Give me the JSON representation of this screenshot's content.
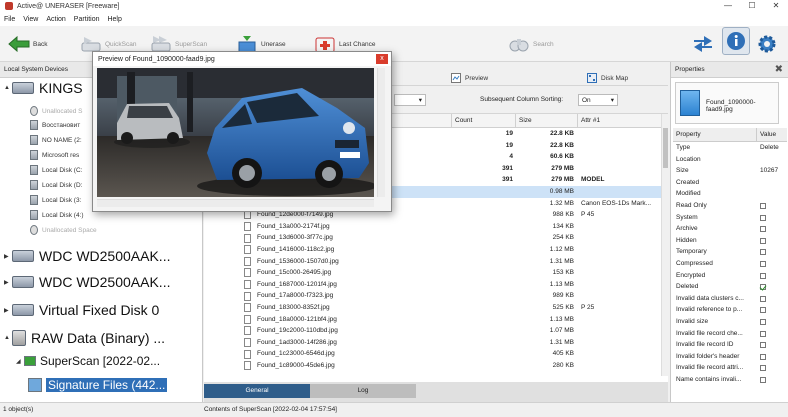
{
  "window": {
    "title": "Active@ UNERASER [Freeware]",
    "minimize": "—",
    "maximize": "☐",
    "close": "✕"
  },
  "menu": [
    "File",
    "View",
    "Action",
    "Partition",
    "Help"
  ],
  "toolbar": {
    "back": "Back",
    "quickscan": "QuickScan",
    "superscan": "SuperScan",
    "unerase": "Unerase",
    "lastchance": "Last Chance",
    "search": "Search"
  },
  "left_pane": {
    "header": "Local System Devices",
    "items": [
      {
        "label": "KINGS",
        "kind": "disk"
      },
      {
        "label": "Unallocated S",
        "kind": "unalloc"
      },
      {
        "label": "Восстановит",
        "kind": "vol"
      },
      {
        "label": "NO NAME (2:",
        "kind": "vol"
      },
      {
        "label": "Microsoft res",
        "kind": "vol"
      },
      {
        "label": "Local Disk (C:",
        "kind": "vol"
      },
      {
        "label": "Local Disk (D:",
        "kind": "vol"
      },
      {
        "label": "Local Disk (3:",
        "kind": "vol"
      },
      {
        "label": "Local Disk (4:)",
        "kind": "vol"
      },
      {
        "label": "Unallocated Space",
        "kind": "unalloc"
      },
      {
        "label": "WDC WD2500AAK...",
        "kind": "disk"
      },
      {
        "label": "WDC WD2500AAK...",
        "kind": "disk"
      },
      {
        "label": "Virtual Fixed Disk 0",
        "kind": "disk"
      },
      {
        "label": "RAW Data (Binary) ...",
        "kind": "raw"
      },
      {
        "label": "SuperScan [2022-02...",
        "kind": "scan"
      },
      {
        "label": "Signature Files (442...",
        "kind": "sig"
      }
    ]
  },
  "middle": {
    "preview_btn": "Preview",
    "diskmap_btn": "Disk Map",
    "subsequent_label": "Subsequent Column Sorting:",
    "subsequent_value": "On",
    "columns": [
      "Count",
      "Size",
      "Attr #1"
    ],
    "rows": [
      {
        "name": "",
        "count": "19",
        "size": "22.8 KB",
        "attr": "",
        "bold": true
      },
      {
        "name": "",
        "count": "19",
        "size": "22.8 KB",
        "attr": "",
        "bold": true
      },
      {
        "name": "",
        "count": "4",
        "size": "60.6 KB",
        "attr": "",
        "bold": true
      },
      {
        "name": "",
        "count": "391",
        "size": "279 MB",
        "attr": "",
        "bold": true
      },
      {
        "name": "",
        "count": "391",
        "size": "279 MB",
        "attr": "MODEL",
        "bold": true
      },
      {
        "name": "",
        "count": "",
        "size": "0.98 MB",
        "attr": "",
        "sel": true
      },
      {
        "name": "",
        "count": "",
        "size": "1.32 MB",
        "attr": "Canon EOS-1Ds Mark..."
      },
      {
        "name": "Found_12de000-f7149.jpg",
        "count": "",
        "size": "988 KB",
        "attr": "P 45"
      },
      {
        "name": "Found_13a000-2174f.jpg",
        "count": "",
        "size": "134 KB",
        "attr": ""
      },
      {
        "name": "Found_13d6000-3f77c.jpg",
        "count": "",
        "size": "254 KB",
        "attr": ""
      },
      {
        "name": "Found_1416000-118c2.jpg",
        "count": "",
        "size": "1.12 MB",
        "attr": ""
      },
      {
        "name": "Found_1536000-1507d0.jpg",
        "count": "",
        "size": "1.31 MB",
        "attr": ""
      },
      {
        "name": "Found_15c000-26495.jpg",
        "count": "",
        "size": "153 KB",
        "attr": ""
      },
      {
        "name": "Found_1687000-1201f4.jpg",
        "count": "",
        "size": "1.13 MB",
        "attr": ""
      },
      {
        "name": "Found_17a8000-f7323.jpg",
        "count": "",
        "size": "989 KB",
        "attr": ""
      },
      {
        "name": "Found_183000-8352f.jpg",
        "count": "",
        "size": "525 KB",
        "attr": "P 25"
      },
      {
        "name": "Found_18a0000-121bf4.jpg",
        "count": "",
        "size": "1.13 MB",
        "attr": ""
      },
      {
        "name": "Found_19c2000-110dbd.jpg",
        "count": "",
        "size": "1.07 MB",
        "attr": ""
      },
      {
        "name": "Found_1ad3000-14f286.jpg",
        "count": "",
        "size": "1.31 MB",
        "attr": ""
      },
      {
        "name": "Found_1c23000-6546d.jpg",
        "count": "",
        "size": "405 KB",
        "attr": ""
      },
      {
        "name": "Found_1c89000-45de6.jpg",
        "count": "",
        "size": "280 KB",
        "attr": ""
      }
    ],
    "tabs": [
      "General",
      "Log"
    ]
  },
  "preview": {
    "title": "Preview of Found_1090000-faad9.jpg",
    "close": "x"
  },
  "right_pane": {
    "header": "Properties",
    "file_name": "Found_1090000-faad9.jpg",
    "col_property": "Property",
    "col_value": "Value",
    "props": [
      {
        "name": "Type",
        "value": "Delete"
      },
      {
        "name": "Location",
        "value": ""
      },
      {
        "name": "Size",
        "value": "10267"
      },
      {
        "name": "Created",
        "value": ""
      },
      {
        "name": "Modified",
        "value": ""
      },
      {
        "name": "Read Only",
        "check": false
      },
      {
        "name": "System",
        "check": false
      },
      {
        "name": "Archive",
        "check": false
      },
      {
        "name": "Hidden",
        "check": false
      },
      {
        "name": "Temporary",
        "check": false
      },
      {
        "name": "Compressed",
        "check": false
      },
      {
        "name": "Encrypted",
        "check": false
      },
      {
        "name": "Deleted",
        "check": true
      },
      {
        "name": "Invalid data clusters c...",
        "check": false
      },
      {
        "name": "Invalid reference to p...",
        "check": false
      },
      {
        "name": "Invalid size",
        "check": false
      },
      {
        "name": "Invalid file record che...",
        "check": false
      },
      {
        "name": "Invalid file record ID",
        "check": false
      },
      {
        "name": "Invalid folder's header",
        "check": false
      },
      {
        "name": "Invalid file record attri...",
        "check": false
      },
      {
        "name": "Name contains invali...",
        "check": false
      }
    ]
  },
  "status": {
    "left": "1 object(s)",
    "middle": "Contents of SuperScan [2022-02-04 17:57:54]"
  },
  "colors": {
    "accent": "#2f5d8a",
    "selection": "#cde2f7",
    "close_red": "#d93c2c"
  }
}
